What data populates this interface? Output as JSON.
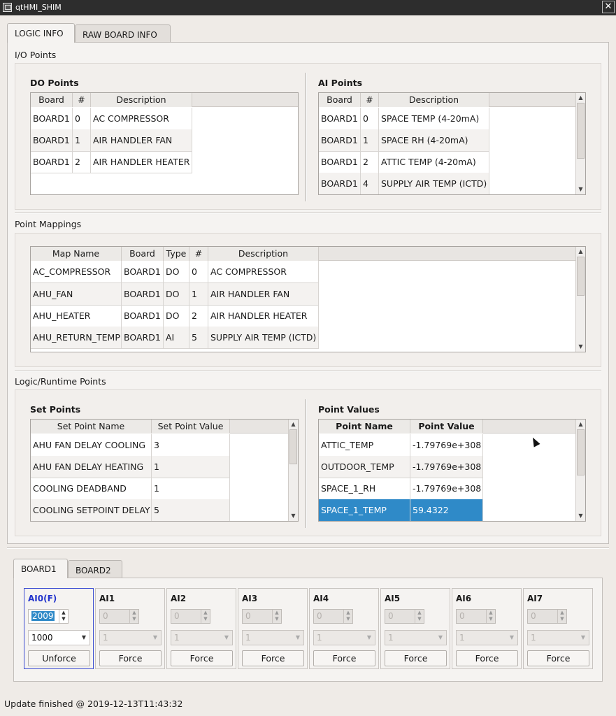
{
  "window": {
    "title": "qtHMI_SHIM",
    "close_glyph": "✕"
  },
  "top_tabs": [
    {
      "label": "LOGIC INFO",
      "active": true
    },
    {
      "label": "RAW BOARD INFO",
      "active": false
    }
  ],
  "io_points": {
    "label": "I/O Points",
    "do_points": {
      "title": "DO Points",
      "columns": [
        "Board",
        "#",
        "Description"
      ],
      "rows": [
        [
          "BOARD1",
          "0",
          "AC COMPRESSOR"
        ],
        [
          "BOARD1",
          "1",
          "AIR HANDLER FAN"
        ],
        [
          "BOARD1",
          "2",
          "AIR HANDLER HEATER"
        ]
      ]
    },
    "ai_points": {
      "title": "AI Points",
      "columns": [
        "Board",
        "#",
        "Description"
      ],
      "rows": [
        [
          "BOARD1",
          "0",
          "SPACE TEMP (4-20mA)"
        ],
        [
          "BOARD1",
          "1",
          "SPACE RH (4-20mA)"
        ],
        [
          "BOARD1",
          "2",
          "ATTIC TEMP (4-20mA)"
        ],
        [
          "BOARD1",
          "4",
          "SUPPLY AIR TEMP (ICTD)"
        ]
      ]
    }
  },
  "point_mappings": {
    "label": "Point Mappings",
    "columns": [
      "Map Name",
      "Board",
      "Type",
      "#",
      "Description"
    ],
    "rows": [
      [
        "AC_COMPRESSOR",
        "BOARD1",
        "DO",
        "0",
        "AC COMPRESSOR"
      ],
      [
        "AHU_FAN",
        "BOARD1",
        "DO",
        "1",
        "AIR HANDLER FAN"
      ],
      [
        "AHU_HEATER",
        "BOARD1",
        "DO",
        "2",
        "AIR HANDLER HEATER"
      ],
      [
        "AHU_RETURN_TEMP",
        "BOARD1",
        "AI",
        "5",
        "SUPPLY AIR TEMP (ICTD)"
      ]
    ]
  },
  "logic_runtime": {
    "label": "Logic/Runtime Points",
    "set_points": {
      "title": "Set Points",
      "columns": [
        "Set Point Name",
        "Set Point Value"
      ],
      "rows": [
        [
          "AHU FAN DELAY COOLING",
          "3"
        ],
        [
          "AHU FAN DELAY HEATING",
          "1"
        ],
        [
          "COOLING DEADBAND",
          "1"
        ],
        [
          "COOLING SETPOINT DELAY",
          "5"
        ]
      ]
    },
    "point_values": {
      "title": "Point Values",
      "columns": [
        "Point Name",
        "Point Value"
      ],
      "rows": [
        [
          "ATTIC_TEMP",
          "-1.79769e+308"
        ],
        [
          "OUTDOOR_TEMP",
          "-1.79769e+308"
        ],
        [
          "SPACE_1_RH",
          "-1.79769e+308"
        ],
        [
          "SPACE_1_TEMP",
          "59.4322"
        ]
      ],
      "selected_row": "SPACE_1_TEMP"
    }
  },
  "board_tabs": [
    {
      "label": "BOARD1",
      "active": true
    },
    {
      "label": "BOARD2",
      "active": false
    }
  ],
  "ai_channels": [
    {
      "label": "AI0(F)",
      "spin_value": "2009",
      "combo_value": "1000",
      "button": "Unforce",
      "enabled": true
    },
    {
      "label": "AI1",
      "spin_value": "0",
      "combo_value": "1",
      "button": "Force",
      "enabled": false
    },
    {
      "label": "AI2",
      "spin_value": "0",
      "combo_value": "1",
      "button": "Force",
      "enabled": false
    },
    {
      "label": "AI3",
      "spin_value": "0",
      "combo_value": "1",
      "button": "Force",
      "enabled": false
    },
    {
      "label": "AI4",
      "spin_value": "0",
      "combo_value": "1",
      "button": "Force",
      "enabled": false
    },
    {
      "label": "AI5",
      "spin_value": "0",
      "combo_value": "1",
      "button": "Force",
      "enabled": false
    },
    {
      "label": "AI6",
      "spin_value": "0",
      "combo_value": "1",
      "button": "Force",
      "enabled": false
    },
    {
      "label": "AI7",
      "spin_value": "0",
      "combo_value": "1",
      "button": "Force",
      "enabled": false
    }
  ],
  "status": "Update finished @ 2019-12-13T11:43:32",
  "colors": {
    "selection": "#2f8ac8",
    "active_border": "#3d4ed2",
    "titlebar": "#2d2d2d"
  }
}
